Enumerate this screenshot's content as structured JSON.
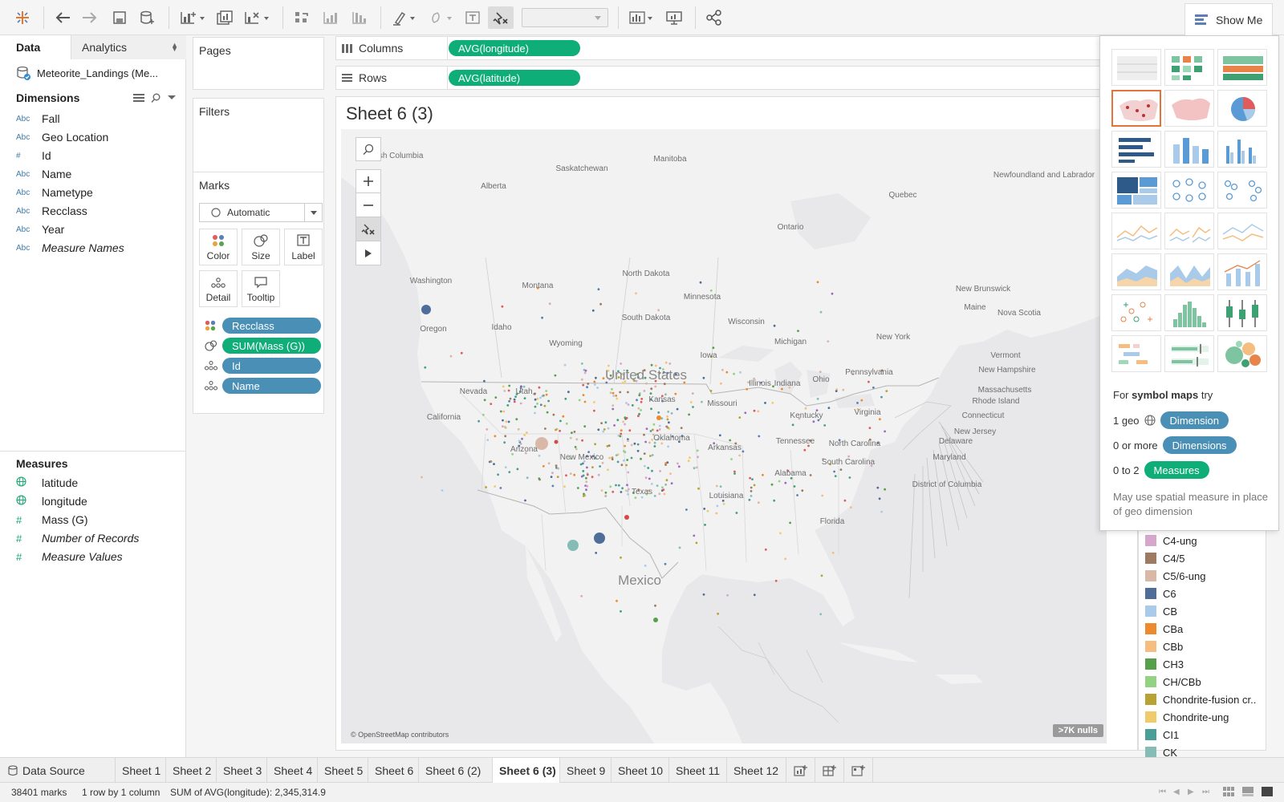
{
  "toolbar": {
    "show_me_label": "Show Me"
  },
  "data_pane": {
    "tab_data": "Data",
    "tab_analytics": "Analytics",
    "datasource": "Meteorite_Landings (Me...",
    "dimensions_label": "Dimensions",
    "dimensions": [
      {
        "type": "Abc",
        "name": "Fall"
      },
      {
        "type": "Abc",
        "name": "Geo Location"
      },
      {
        "type": "#",
        "name": "Id"
      },
      {
        "type": "Abc",
        "name": "Name"
      },
      {
        "type": "Abc",
        "name": "Nametype"
      },
      {
        "type": "Abc",
        "name": "Recclass"
      },
      {
        "type": "Abc",
        "name": "Year"
      },
      {
        "type": "Abc",
        "name": "Measure Names"
      }
    ],
    "measures_label": "Measures",
    "measures": [
      {
        "type": "globe",
        "name": "latitude"
      },
      {
        "type": "globe",
        "name": "longitude"
      },
      {
        "type": "#",
        "name": "Mass (G)"
      },
      {
        "type": "#",
        "name": "Number of Records"
      },
      {
        "type": "#",
        "name": "Measure Values"
      }
    ]
  },
  "cards": {
    "pages": "Pages",
    "filters": "Filters",
    "marks": "Marks",
    "mark_type": "Automatic",
    "buttons": [
      "Color",
      "Size",
      "Label",
      "Detail",
      "Tooltip"
    ],
    "pills": [
      {
        "icon": "color",
        "label": "Recclass",
        "kind": "dimension"
      },
      {
        "icon": "size",
        "label": "SUM(Mass (G))",
        "kind": "measure"
      },
      {
        "icon": "detail",
        "label": "Id",
        "kind": "dimension"
      },
      {
        "icon": "detail",
        "label": "Name",
        "kind": "dimension"
      }
    ]
  },
  "shelves": {
    "columns_label": "Columns",
    "columns_pill": "AVG(longitude)",
    "rows_label": "Rows",
    "rows_pill": "AVG(latitude)"
  },
  "view": {
    "title": "Sheet 6 (3)",
    "attribution": "© OpenStreetMap contributors",
    "nulls": ">7K nulls",
    "map_labels": [
      "British Columbia",
      "Alberta",
      "Saskatchewan",
      "Manitoba",
      "Ontario",
      "Quebec",
      "Newfoundland and Labrador",
      "New Brunswick",
      "Nova Scotia",
      "Washington",
      "Oregon",
      "Idaho",
      "Montana",
      "Wyoming",
      "North Dakota",
      "South Dakota",
      "Minnesota",
      "Wisconsin",
      "Michigan",
      "Iowa",
      "Nevada",
      "Utah",
      "California",
      "Arizona",
      "New Mexico",
      "Texas",
      "Oklahoma",
      "Kansas",
      "Missouri",
      "Arkansas",
      "Louisiana",
      "Illinois",
      "Indiana",
      "Ohio",
      "Kentucky",
      "Tennessee",
      "Alabama",
      "Florida",
      "Pennsylvania",
      "New York",
      "Virginia",
      "North Carolina",
      "South Carolina",
      "Maine",
      "Vermont",
      "New Hampshire",
      "Massachusetts",
      "Rhode Island",
      "Connecticut",
      "New Jersey",
      "Delaware",
      "Maryland",
      "District of Columbia",
      "United States",
      "Mexico"
    ]
  },
  "legend": {
    "items": [
      {
        "label": "C4-ung",
        "color": "#d7a6cc"
      },
      {
        "label": "C4/5",
        "color": "#9e7a61"
      },
      {
        "label": "C5/6-ung",
        "color": "#d9b8a7"
      },
      {
        "label": "C6",
        "color": "#4e6d99"
      },
      {
        "label": "CB",
        "color": "#a9cbe9"
      },
      {
        "label": "CBa",
        "color": "#ed8a2d"
      },
      {
        "label": "CBb",
        "color": "#f5bd7f"
      },
      {
        "label": "CH3",
        "color": "#55a149"
      },
      {
        "label": "CH/CBb",
        "color": "#92d283"
      },
      {
        "label": "Chondrite-fusion cr..",
        "color": "#b8a233"
      },
      {
        "label": "Chondrite-ung",
        "color": "#f0cb6a"
      },
      {
        "label": "CI1",
        "color": "#4a9e98"
      },
      {
        "label": "CK",
        "color": "#86bcb6"
      }
    ]
  },
  "show_me": {
    "hint_prefix": "For ",
    "hint_bold": "symbol maps",
    "hint_suffix": " try",
    "req1_text": "1 geo",
    "req1_pill": "Dimension",
    "req2_text": "0 or more",
    "req2_pill": "Dimensions",
    "req3_text": "0 to 2",
    "req3_pill": "Measures",
    "note": "May use spatial measure in place of geo dimension"
  },
  "sheet_tabs": {
    "datasource": "Data Source",
    "tabs": [
      "Sheet 1",
      "Sheet 2",
      "Sheet 3",
      "Sheet 4",
      "Sheet 5",
      "Sheet 6",
      "Sheet 6 (2)",
      "Sheet 6 (3)",
      "Sheet 9",
      "Sheet 10",
      "Sheet 11",
      "Sheet 12"
    ],
    "active": "Sheet 6 (3)"
  },
  "status": {
    "marks": "38401 marks",
    "dims": "1 row by 1 column",
    "sum": "SUM of AVG(longitude): 2,345,314.9"
  },
  "colors": {
    "accent": "#e3733b",
    "dimension_pill": "#4a8fb5",
    "measure_pill": "#0fad78"
  }
}
